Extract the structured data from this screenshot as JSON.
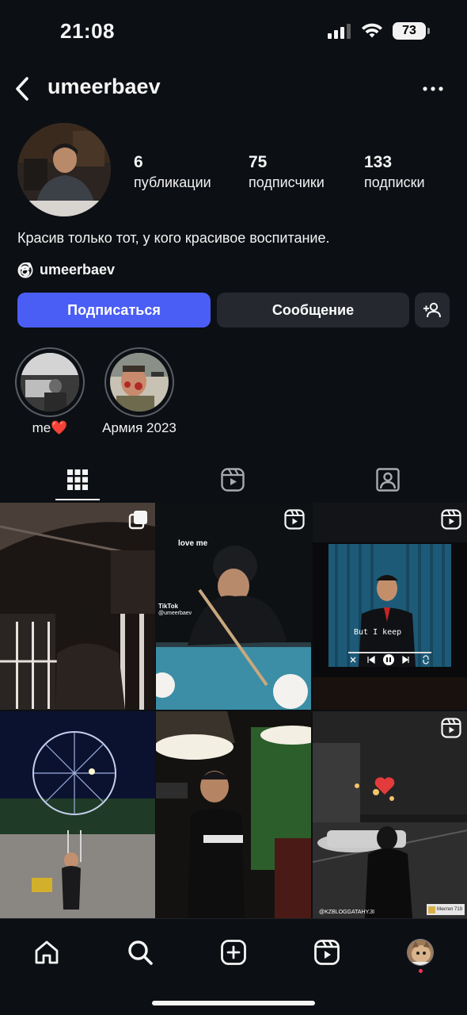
{
  "status_bar": {
    "time": "21:08",
    "battery": "73"
  },
  "header": {
    "username": "umeerbaev"
  },
  "profile": {
    "stats": [
      {
        "number": "6",
        "label": "публикации"
      },
      {
        "number": "75",
        "label": "подписчики"
      },
      {
        "number": "133",
        "label": "подписки"
      }
    ],
    "bio": "Красив только тот, у кого красивое воспитание.",
    "threads_handle": "umeerbaev"
  },
  "actions": {
    "follow_label": "Подписаться",
    "message_label": "Сообщение"
  },
  "highlights": [
    {
      "label": "me❤️"
    },
    {
      "label": "Армия 2023"
    }
  ],
  "tabs": [
    {
      "name": "grid-icon",
      "active": true
    },
    {
      "name": "reels-icon",
      "active": false
    },
    {
      "name": "tagged-icon",
      "active": false
    }
  ],
  "posts": {
    "p2_caption": "love me",
    "p2_tiktok": "TikTok",
    "p2_handle": "@umeerbaev",
    "p3_caption": "But I keep",
    "p6_watermark": "@KZBLOGGATAHY.3I",
    "p6_label": "Мектеп 719"
  },
  "bottom_nav": [
    "home-icon",
    "search-icon",
    "create-icon",
    "reels-icon",
    "profile-avatar"
  ],
  "colors": {
    "accent": "#4a5ef5",
    "background": "#0c0f14",
    "secondary_button": "#25282e",
    "notification_dot": "#ff2f56"
  }
}
